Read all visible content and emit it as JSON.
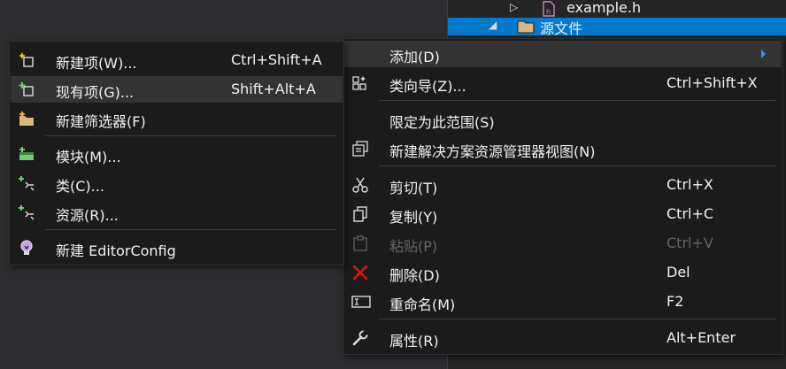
{
  "explorer": {
    "rows": [
      {
        "label": "example.h",
        "arrow": "▷"
      },
      {
        "label": "源文件",
        "arrow": "◢"
      }
    ]
  },
  "context_menu": {
    "items": [
      {
        "label": "添加(D)",
        "shortcut": "",
        "icon": "none",
        "submenu": true
      },
      {
        "label": "类向导(Z)...",
        "shortcut": "Ctrl+Shift+X",
        "icon": "class-wizard-icon"
      },
      {
        "label": "限定为此范围(S)",
        "shortcut": "",
        "icon": "none"
      },
      {
        "label": "新建解决方案资源管理器视图(N)",
        "shortcut": "",
        "icon": "new-explorer-view-icon"
      },
      {
        "label": "剪切(T)",
        "shortcut": "Ctrl+X",
        "icon": "scissors-icon"
      },
      {
        "label": "复制(Y)",
        "shortcut": "Ctrl+C",
        "icon": "copy-icon"
      },
      {
        "label": "粘贴(P)",
        "shortcut": "Ctrl+V",
        "icon": "paste-icon",
        "disabled": true
      },
      {
        "label": "删除(D)",
        "shortcut": "Del",
        "icon": "delete-x-icon"
      },
      {
        "label": "重命名(M)",
        "shortcut": "F2",
        "icon": "rename-icon"
      },
      {
        "label": "属性(R)",
        "shortcut": "Alt+Enter",
        "icon": "wrench-icon"
      }
    ]
  },
  "add_submenu": {
    "items": [
      {
        "label": "新建项(W)...",
        "shortcut": "Ctrl+Shift+A",
        "icon": "new-item-icon"
      },
      {
        "label": "现有项(G)...",
        "shortcut": "Shift+Alt+A",
        "icon": "existing-item-icon"
      },
      {
        "label": "新建筛选器(F)",
        "shortcut": "",
        "icon": "new-filter-folder-icon"
      },
      {
        "label": "模块(M)...",
        "shortcut": "",
        "icon": "module-icon"
      },
      {
        "label": "类(C)...",
        "shortcut": "",
        "icon": "class-icon"
      },
      {
        "label": "资源(R)...",
        "shortcut": "",
        "icon": "resource-icon"
      },
      {
        "label": "新建 EditorConfig",
        "shortcut": "",
        "icon": "lightbulb-icon"
      }
    ]
  },
  "colors": {
    "background": "#2d2d30",
    "menu_bg": "#1b1b1c",
    "selection": "#007acc",
    "highlight": "#333334",
    "accent_arrow": "#3794ff",
    "delete_red": "#e51400",
    "star_gold": "#e8b923",
    "plus_green": "#6fcf6f"
  }
}
